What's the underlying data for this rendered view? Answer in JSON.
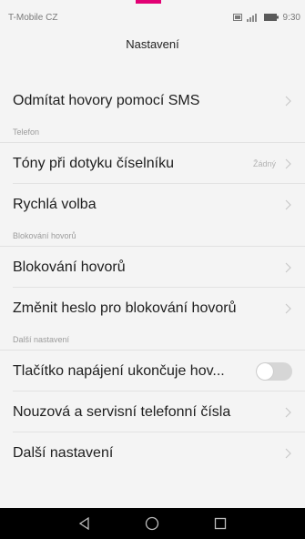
{
  "colors": {
    "accent": "#e20074",
    "background": "#f4f4f4",
    "navbar": "#000000"
  },
  "status_bar": {
    "carrier": "T-Mobile CZ",
    "time": "9:30",
    "icons": [
      "sim-icon",
      "signal-icon",
      "battery-icon"
    ]
  },
  "header": {
    "title": "Nastavení"
  },
  "rows": {
    "sms_reject": {
      "label": "Odmítat hovory pomocí SMS"
    },
    "dialpad_tones": {
      "label": "Tóny při dotyku číselníku",
      "value": "Žádný"
    },
    "speed_dial": {
      "label": "Rychlá volba"
    },
    "call_barring": {
      "label": "Blokování hovorů"
    },
    "barring_password": {
      "label": "Změnit heslo pro blokování hovorů"
    },
    "power_ends_call": {
      "label": "Tlačítko napájení ukončuje hov...",
      "toggle": false
    },
    "emergency_numbers": {
      "label": "Nouzová a servisní telefonní čísla"
    },
    "more_settings": {
      "label": "Další nastavení"
    }
  },
  "sections": {
    "phone": "Telefon",
    "call_blocking": "Blokování hovorů",
    "more": "Další nastavení"
  },
  "nav": {
    "icons": [
      "back-icon",
      "home-icon",
      "recents-icon"
    ]
  }
}
